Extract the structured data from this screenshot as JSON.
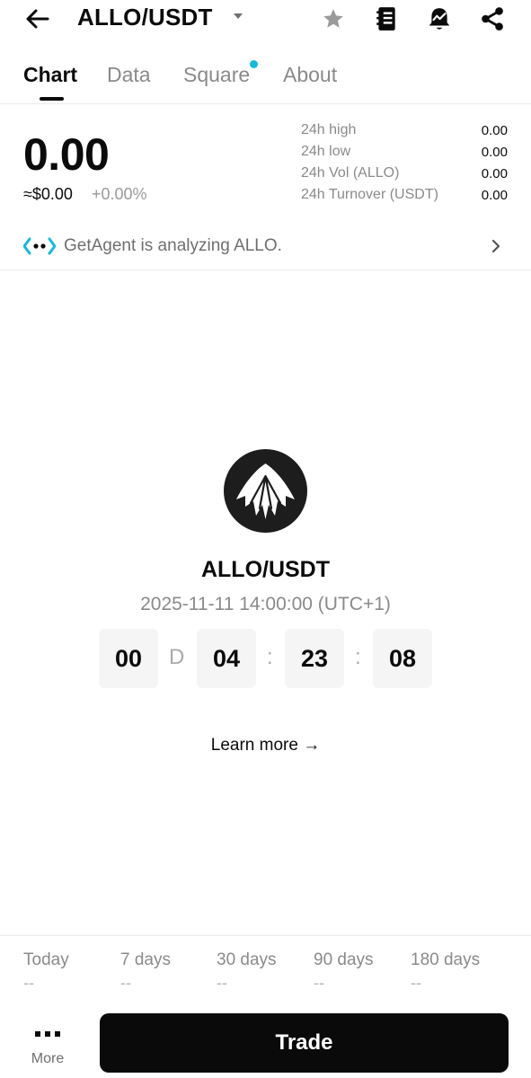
{
  "header": {
    "pair": "ALLO/USDT",
    "icons": [
      "back-arrow-icon",
      "caret-down-icon",
      "star-icon",
      "notebook-icon",
      "price-alert-icon",
      "share-icon"
    ]
  },
  "tabs": [
    {
      "label": "Chart",
      "active": true
    },
    {
      "label": "Data",
      "active": false
    },
    {
      "label": "Square",
      "active": false,
      "badge": true
    },
    {
      "label": "About",
      "active": false
    }
  ],
  "price": {
    "last": "0.00",
    "usd": "≈$0.00",
    "change": "+0.00%"
  },
  "stats": [
    {
      "label": "24h high",
      "value": "0.00"
    },
    {
      "label": "24h low",
      "value": "0.00"
    },
    {
      "label": "24h Vol (ALLO)",
      "value": "0.00"
    },
    {
      "label": "24h Turnover (USDT)",
      "value": "0.00"
    }
  ],
  "agent": {
    "text": "GetAgent is analyzing ALLO.",
    "accent": "#19b8d8"
  },
  "launch": {
    "pair": "ALLO/USDT",
    "time": "2025-11-11 14:00:00 (UTC+1)",
    "countdown": {
      "days": "00",
      "day_unit": "D",
      "hours": "04",
      "minutes": "23",
      "seconds": "08",
      "separator": ":"
    },
    "learn_more": "Learn more →"
  },
  "performance": [
    {
      "label": "Today",
      "value": "--"
    },
    {
      "label": "7 days",
      "value": "--"
    },
    {
      "label": "30 days",
      "value": "--"
    },
    {
      "label": "90 days",
      "value": "--"
    },
    {
      "label": "180 days",
      "value": "--"
    }
  ],
  "bottom": {
    "more_label": "More",
    "trade_label": "Trade"
  },
  "colors": {
    "text": "#0b0b0b",
    "muted": "#8a8a8a",
    "button": "#0a0a0a",
    "accent": "#19b8d8"
  }
}
